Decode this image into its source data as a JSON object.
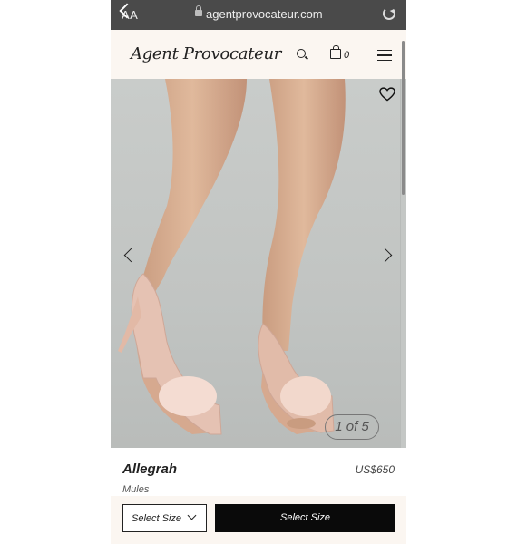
{
  "browser": {
    "text_size_label": "AA",
    "url": "agentprovocateur.com"
  },
  "header": {
    "logo": "Agent Provocateur",
    "bag_count": "0"
  },
  "gallery": {
    "counter": "1 of 5"
  },
  "product": {
    "name": "Allegrah",
    "price": "US$650",
    "category": "Mules"
  },
  "actions": {
    "size_select_label": "Select Size",
    "select_size_button": "Select Size"
  },
  "colors": {
    "header_bg": "#fbf6f1",
    "button_bg": "#0a0a0a",
    "image_bg": "#c4c7c5"
  }
}
